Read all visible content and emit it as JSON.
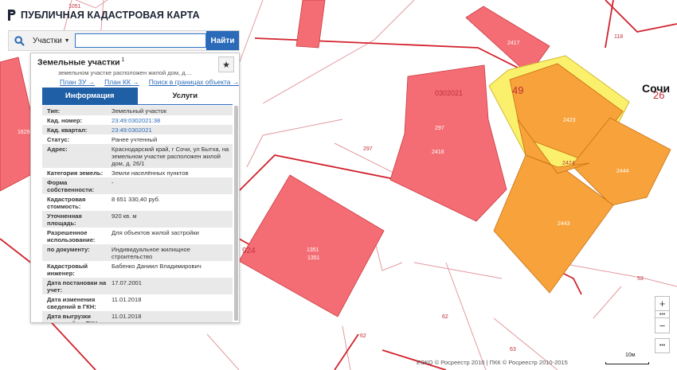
{
  "header": {
    "title": "ПУБЛИЧНАЯ КАДАСТРОВАЯ КАРТА"
  },
  "search": {
    "type_label": "Участки",
    "value": "",
    "placeholder": "",
    "submit_label": "Найти"
  },
  "panel": {
    "title": "Земельные участки",
    "title_count": "1",
    "address_snippet": "земельном участке расположен жилой дом, д....",
    "links": [
      "План ЗУ →",
      "План КК →",
      "Поиск в границах объекта →"
    ],
    "tabs": [
      "Информация",
      "Услуги"
    ],
    "rows": [
      {
        "k": "Тип:",
        "v": "Земельный участок"
      },
      {
        "k": "Кад. номер:",
        "v": "23:49:0302021:38"
      },
      {
        "k": "Кад. квартал:",
        "v": "23:49:0302021"
      },
      {
        "k": "Статус:",
        "v": "Ранее учтенный"
      },
      {
        "k": "Адрес:",
        "v": "Краснодарский край, г Сочи, ул Бытха, на земельном участке расположен жилой дом, д. 26/1"
      },
      {
        "k": "Категория земель:",
        "v": "Земли населённых пунктов"
      },
      {
        "k": "Форма собственности:",
        "v": "-"
      },
      {
        "k": "Кадастровая стоимость:",
        "v": "8 651 330,40 руб."
      },
      {
        "k": "Уточненная площадь:",
        "v": "920 кв. м"
      },
      {
        "k": "Разрешенное использование:",
        "v": "Для объектов жилой застройки"
      },
      {
        "k": "по документу:",
        "v": "Индивидуальное жилищное строительство"
      },
      {
        "k": "Кадастровый инженер:",
        "v": "Бабенко Даниил Владимирович"
      },
      {
        "k": "Дата постановки на учет:",
        "v": "17.07.2001"
      },
      {
        "k": "Дата изменения сведений в ГКН:",
        "v": "11.01.2018"
      },
      {
        "k": "Дата выгрузки сведений из ГКН:",
        "v": "11.01.2018"
      }
    ]
  },
  "map": {
    "city_label": "Сочи",
    "quarter_label": "0302021",
    "big_label": "49",
    "labels": [
      "1051",
      "118",
      "2417",
      "297",
      "2418",
      "1629",
      "297",
      "2423",
      "2444",
      "2443",
      "2424",
      "1351",
      "1351",
      "924",
      "62",
      "62",
      "63",
      "53",
      "26"
    ],
    "colors": {
      "parcel_red": "#f56d74",
      "parcel_orange": "#f7a23a",
      "parcel_yellow": "#fbf06c",
      "boundary": "#d2222d"
    }
  },
  "controls": {
    "zoom_in": "+",
    "zoom_out": "−",
    "more": "•••"
  },
  "footer": {
    "attribution": "ЕЭКО © Росреестр 2010 | ПКК © Росреестр 2010-2015",
    "scale_label": "10м"
  }
}
